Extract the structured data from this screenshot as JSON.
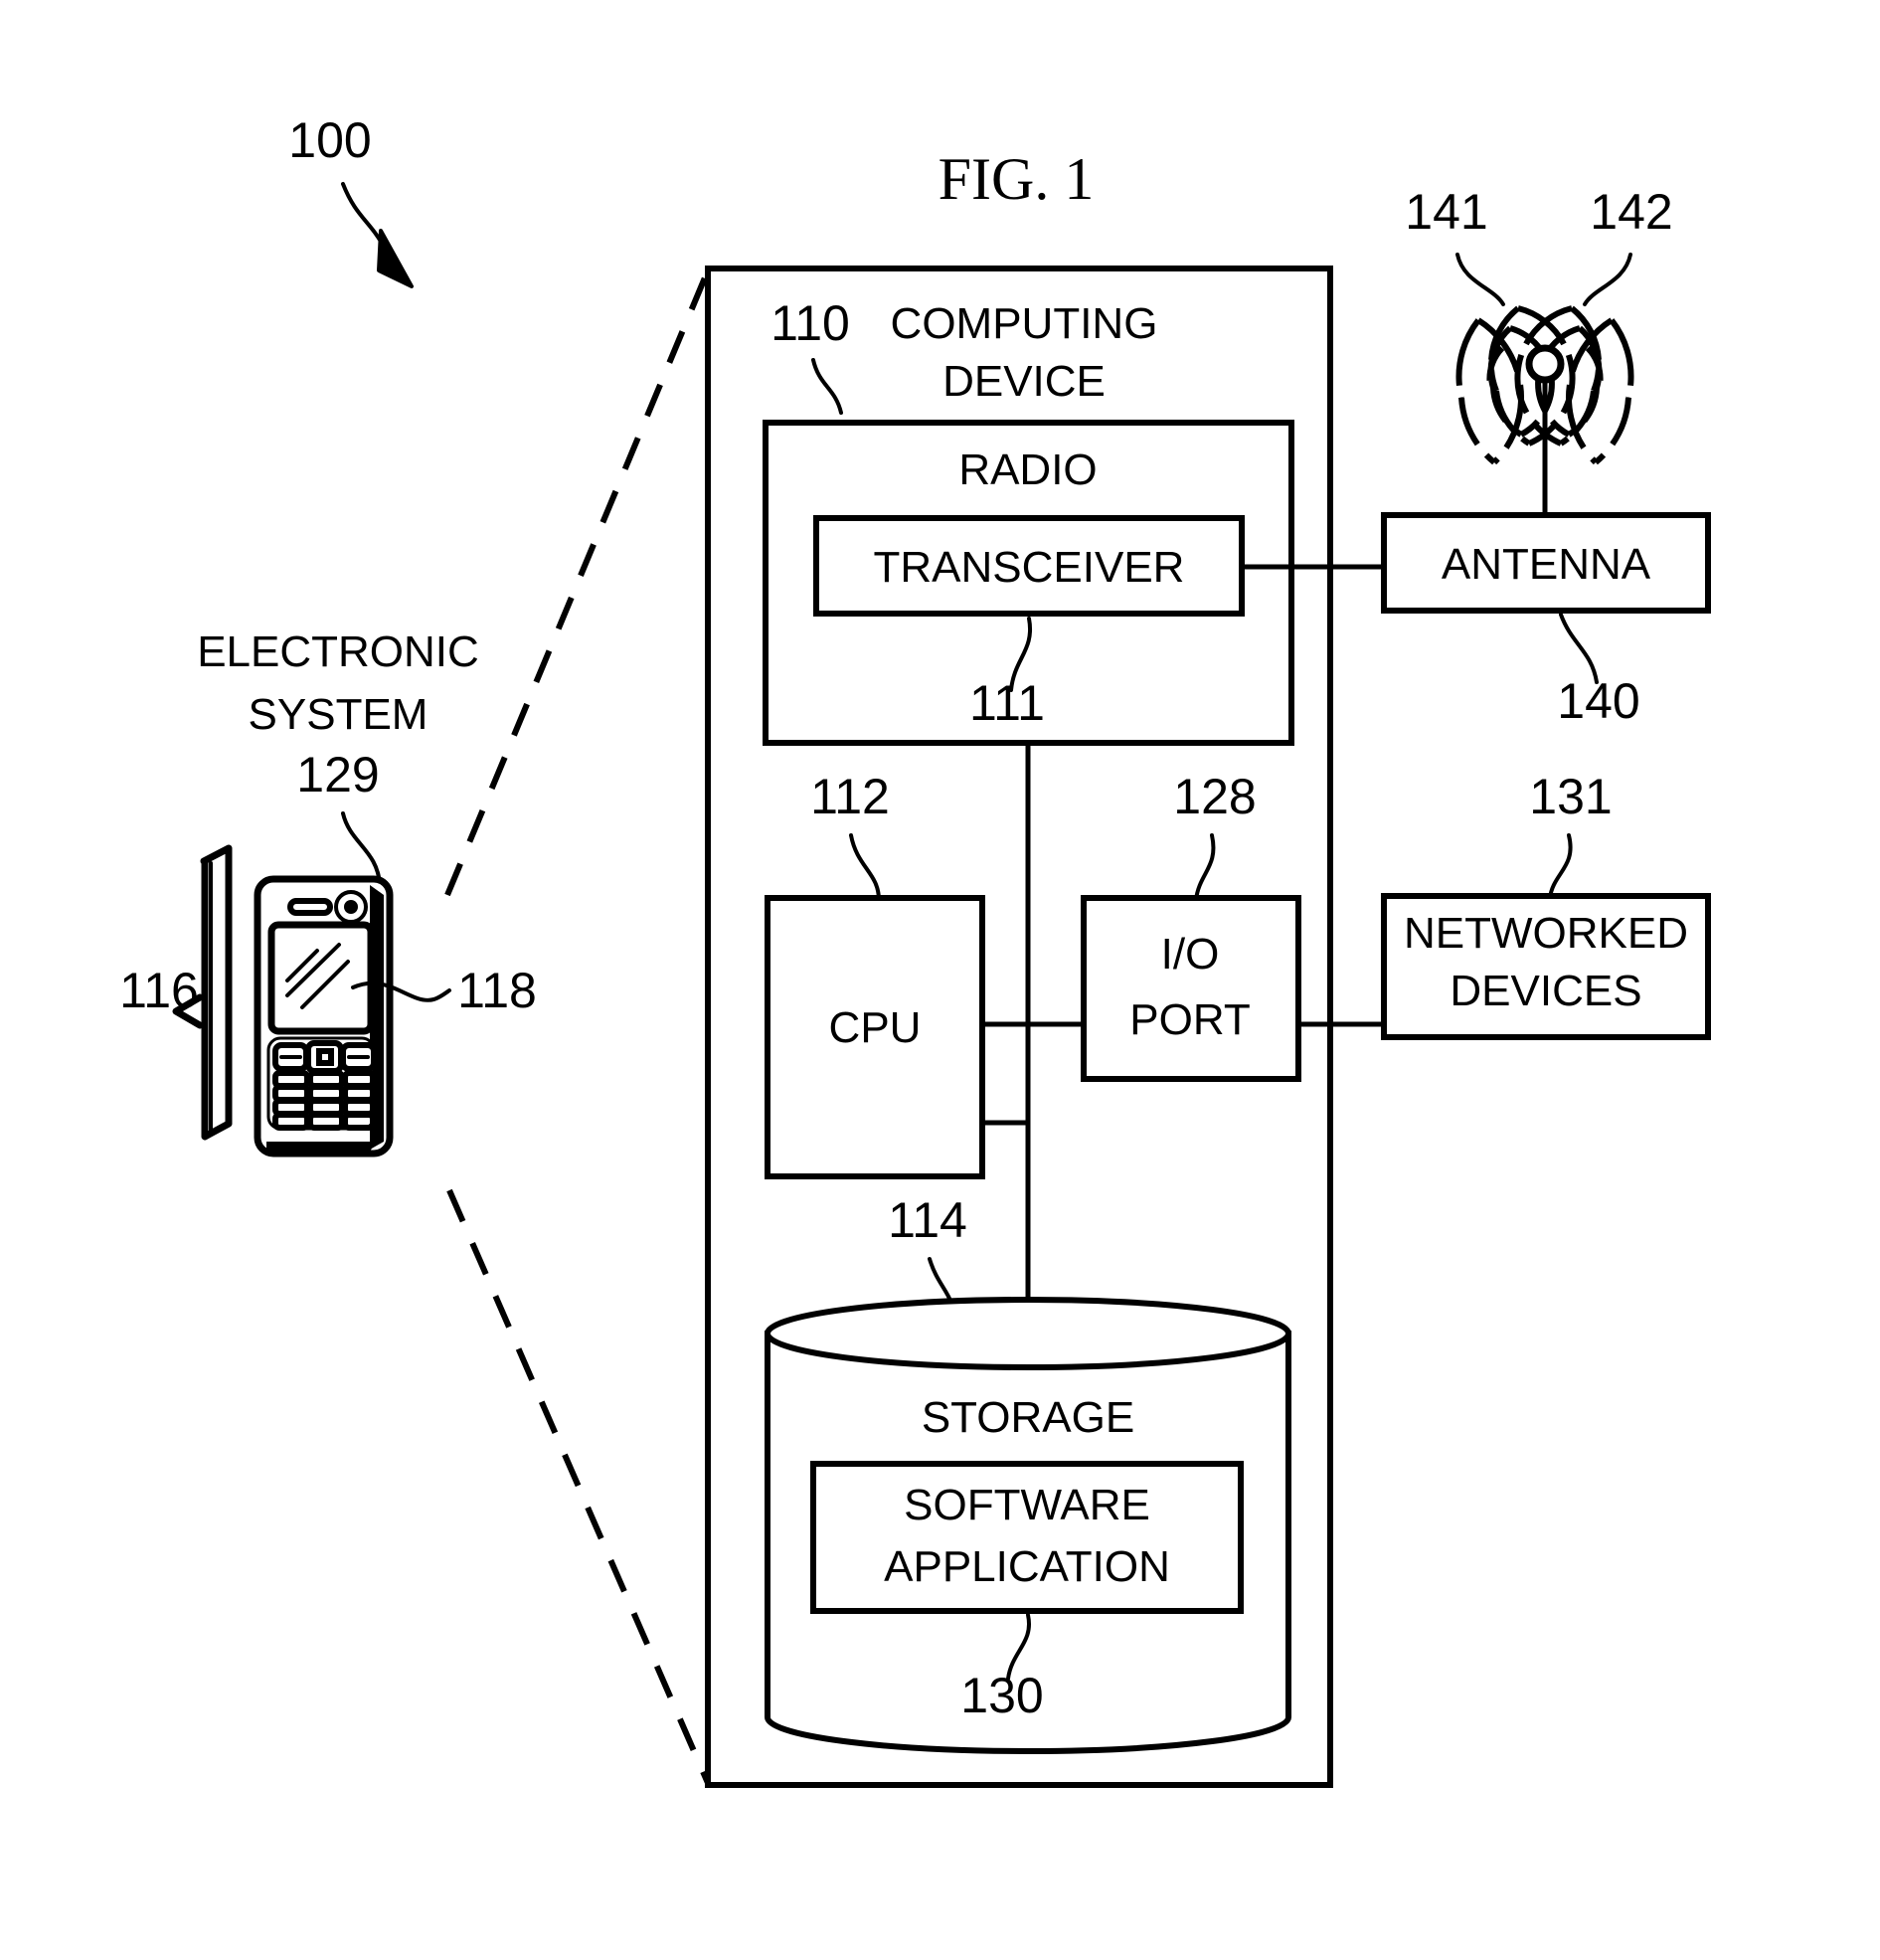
{
  "figure": {
    "title": "FIG. 1",
    "root_ref": "100"
  },
  "left_panel": {
    "caption_line1": "ELECTRONIC",
    "caption_line2": "SYSTEM",
    "caption_ref": "129",
    "display_ref": "118",
    "housing_ref": "116"
  },
  "computing_device": {
    "ref": "110",
    "title_line1": "COMPUTING",
    "title_line2": "DEVICE"
  },
  "radio": {
    "label": "RADIO",
    "transceiver": {
      "label": "TRANSCEIVER",
      "ref": "111"
    }
  },
  "cpu": {
    "label": "CPU",
    "ref": "112"
  },
  "io_port": {
    "label_line1": "I/O",
    "label_line2": "PORT",
    "ref": "128"
  },
  "storage": {
    "label": "STORAGE",
    "ref": "114",
    "software_application": {
      "label_line1": "SOFTWARE",
      "label_line2": "APPLICATION",
      "ref": "130"
    }
  },
  "antenna": {
    "label": "ANTENNA",
    "ref": "140",
    "wave_left_ref": "141",
    "wave_right_ref": "142"
  },
  "networked_devices": {
    "label_line1": "NETWORKED",
    "label_line2": "DEVICES",
    "ref": "131"
  },
  "colors": {
    "ink": "#000000",
    "paper": "#ffffff"
  }
}
